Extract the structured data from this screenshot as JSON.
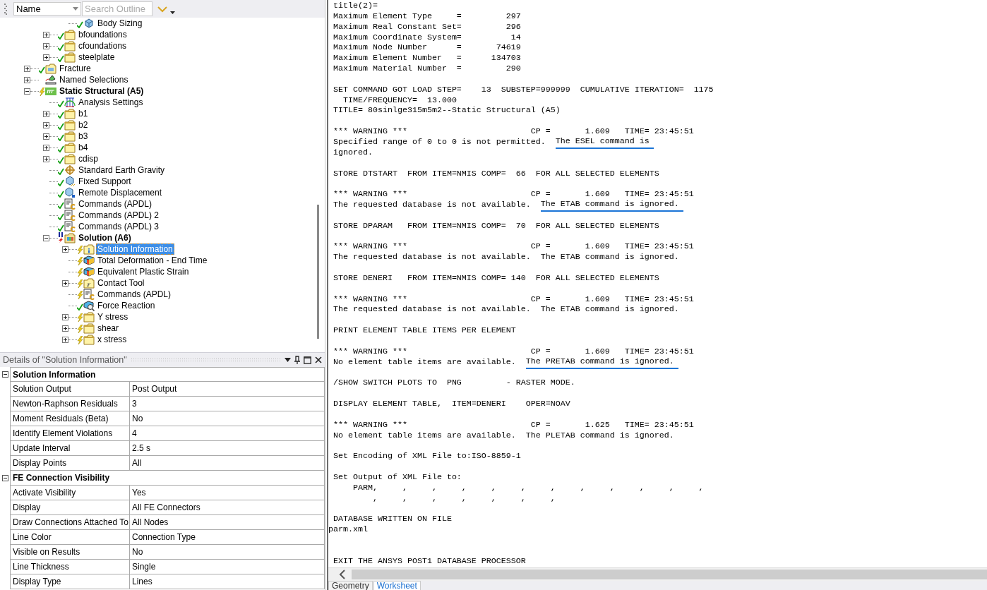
{
  "outline_toolbar": {
    "column_dropdown": "Name",
    "search": {
      "placeholder": "Search Outline"
    }
  },
  "tree": [
    {
      "children": [
        {
          "children": [
            {
              "label": "Body Sizing",
              "kind": "mesh-sizing",
              "up_to_date": true,
              "selected": false
            }
          ]
        },
        {
          "label": "bfoundations",
          "kind": "folder",
          "up_to_date": true,
          "expanded": false,
          "selected": false
        },
        {
          "label": "cfoundations",
          "kind": "folder",
          "up_to_date": true,
          "expanded": false,
          "selected": false
        },
        {
          "label": "steelplate",
          "kind": "folder",
          "up_to_date": true,
          "expanded": false,
          "selected": false
        }
      ]
    },
    {
      "label": "Fracture",
      "kind": "fracture",
      "up_to_date": true,
      "expanded": false,
      "selected": false
    },
    {
      "label": "Named Selections",
      "kind": "named-selection",
      "expanded": false,
      "selected": false
    },
    {
      "label": "Static Structural (A5)",
      "kind": "analysis",
      "up_to_date": false,
      "expanded": true,
      "selected": false,
      "children": [
        {
          "label": "Analysis Settings",
          "kind": "analysis-settings",
          "up_to_date": true,
          "selected": false
        },
        {
          "label": "b1",
          "kind": "folder",
          "up_to_date": true,
          "expanded": false,
          "selected": false
        },
        {
          "label": "b2",
          "kind": "folder",
          "up_to_date": true,
          "expanded": false,
          "selected": false
        },
        {
          "label": "b3",
          "kind": "folder",
          "up_to_date": true,
          "expanded": false,
          "selected": false
        },
        {
          "label": "b4",
          "kind": "folder",
          "up_to_date": true,
          "expanded": false,
          "selected": false
        },
        {
          "label": "cdisp",
          "kind": "folder",
          "up_to_date": true,
          "expanded": false,
          "selected": false
        },
        {
          "label": "Standard Earth Gravity",
          "kind": "gravity",
          "up_to_date": true,
          "selected": false
        },
        {
          "label": "Fixed Support",
          "kind": "fixed-support",
          "up_to_date": true,
          "selected": false
        },
        {
          "label": "Remote Displacement",
          "kind": "remote-displacement",
          "up_to_date": true,
          "selected": false
        },
        {
          "label": "Commands (APDL)",
          "kind": "commands",
          "up_to_date": true,
          "selected": false
        },
        {
          "label": "Commands (APDL) 2",
          "kind": "commands",
          "up_to_date": true,
          "selected": false
        },
        {
          "label": "Commands (APDL) 3",
          "kind": "commands",
          "up_to_date": true,
          "selected": false
        },
        {
          "label": "Solution (A6)",
          "kind": "solution",
          "up_to_date": false,
          "solving": true,
          "expanded": true,
          "selected": false,
          "children": [
            {
              "label": "Solution Information",
              "kind": "solution-info",
              "up_to_date": false,
              "expanded": false,
              "selected": true
            },
            {
              "label": "Total Deformation - End Time",
              "kind": "result",
              "up_to_date": false,
              "selected": false
            },
            {
              "label": "Equivalent Plastic Strain",
              "kind": "result",
              "up_to_date": false,
              "selected": false
            },
            {
              "label": "Contact Tool",
              "kind": "contact-tool",
              "up_to_date": false,
              "expanded": false,
              "selected": false
            },
            {
              "label": "Commands (APDL)",
              "kind": "commands",
              "up_to_date": false,
              "selected": false
            },
            {
              "label": "Force Reaction",
              "kind": "probe",
              "up_to_date": true,
              "selected": false
            },
            {
              "label": "Y stress",
              "kind": "folder",
              "up_to_date": false,
              "expanded": false,
              "selected": false
            },
            {
              "label": "shear",
              "kind": "folder",
              "up_to_date": false,
              "expanded": false,
              "selected": false
            },
            {
              "label": "x stress",
              "kind": "folder",
              "up_to_date": false,
              "expanded": false,
              "selected": false
            }
          ]
        }
      ]
    }
  ],
  "details": {
    "title": "Details of \"Solution Information\"",
    "sections": [
      {
        "title": "Solution Information",
        "expanded": true,
        "rows": [
          {
            "label": "Solution Output",
            "value": "Post Output"
          },
          {
            "label": "Newton-Raphson Residuals",
            "value": "3"
          },
          {
            "label": "Moment Residuals (Beta)",
            "value": "No"
          },
          {
            "label": "Identify Element Violations",
            "value": "4"
          },
          {
            "label": "Update Interval",
            "value": "2.5 s"
          },
          {
            "label": "Display Points",
            "value": "All"
          }
        ]
      },
      {
        "title": "FE Connection Visibility",
        "expanded": true,
        "rows": [
          {
            "label": "Activate Visibility",
            "value": "Yes"
          },
          {
            "label": "Display",
            "value": "All FE Connectors"
          },
          {
            "label": "Draw Connections Attached To",
            "value": "All Nodes"
          },
          {
            "label": "Line Color",
            "value": "Connection Type"
          },
          {
            "label": "Visible on Results",
            "value": "No"
          },
          {
            "label": "Line Thickness",
            "value": "Single"
          },
          {
            "label": "Display Type",
            "value": "Lines"
          }
        ]
      }
    ]
  },
  "log": [
    {
      "kind": "line",
      "text": "title(2)="
    },
    {
      "kind": "line",
      "text": "Maximum Element Type     =         297"
    },
    {
      "kind": "line",
      "text": "Maximum Real Constant Set=         296"
    },
    {
      "kind": "line",
      "text": "Maximum Coordinate System=          14"
    },
    {
      "kind": "line",
      "text": "Maximum Node Number      =       74619"
    },
    {
      "kind": "line",
      "text": "Maximum Element Number   =      134703"
    },
    {
      "kind": "line",
      "text": "Maximum Material Number  =         290"
    },
    {
      "kind": "blank"
    },
    {
      "kind": "line",
      "text": "SET COMMAND GOT LOAD STEP=    13  SUBSTEP=999999  CUMULATIVE ITERATION=  1175"
    },
    {
      "kind": "line",
      "text": "  TIME/FREQUENCY=  13.000"
    },
    {
      "kind": "line",
      "text": "TITLE= 80sinlge315m5m2--Static Structural (A5)"
    },
    {
      "kind": "blank"
    },
    {
      "kind": "line",
      "text": "*** WARNING ***                         CP =       1.609   TIME= 23:45:51"
    },
    {
      "kind": "line",
      "text": "Specified range of 0 to 0 is not permitted.",
      "underlined_text": "The ESEL command is"
    },
    {
      "kind": "line",
      "text": "ignored."
    },
    {
      "kind": "blank"
    },
    {
      "kind": "line",
      "text": "STORE DTSTART  FROM ITEM=NMIS COMP=  66  FOR ALL SELECTED ELEMENTS"
    },
    {
      "kind": "blank"
    },
    {
      "kind": "line",
      "text": "*** WARNING ***                         CP =       1.609   TIME= 23:45:51"
    },
    {
      "kind": "line",
      "text": "The requested database is not available.",
      "underlined_text": "The ETAB command is ignored."
    },
    {
      "kind": "blank"
    },
    {
      "kind": "line",
      "text": "STORE DPARAM   FROM ITEM=NMIS COMP=  70  FOR ALL SELECTED ELEMENTS"
    },
    {
      "kind": "blank"
    },
    {
      "kind": "line",
      "text": "*** WARNING ***                         CP =       1.609   TIME= 23:45:51"
    },
    {
      "kind": "line",
      "text": "The requested database is not available.  The ETAB command is ignored."
    },
    {
      "kind": "blank"
    },
    {
      "kind": "line",
      "text": "STORE DENERI   FROM ITEM=NMIS COMP= 140  FOR ALL SELECTED ELEMENTS"
    },
    {
      "kind": "blank"
    },
    {
      "kind": "line",
      "text": "*** WARNING ***                         CP =       1.609   TIME= 23:45:51"
    },
    {
      "kind": "line",
      "text": "The requested database is not available.  The ETAB command is ignored."
    },
    {
      "kind": "blank"
    },
    {
      "kind": "line",
      "text": "PRINT ELEMENT TABLE ITEMS PER ELEMENT"
    },
    {
      "kind": "blank"
    },
    {
      "kind": "line",
      "text": "*** WARNING ***                         CP =       1.609   TIME= 23:45:51"
    },
    {
      "kind": "line",
      "text": "No element table items are available.",
      "underlined_text": "The PRETAB command is ignored."
    },
    {
      "kind": "blank"
    },
    {
      "kind": "line",
      "text": "/SHOW SWITCH PLOTS TO  PNG         - RASTER MODE."
    },
    {
      "kind": "blank"
    },
    {
      "kind": "line",
      "text": "DISPLAY ELEMENT TABLE,  ITEM=DENERI    OPER=NOAV"
    },
    {
      "kind": "blank"
    },
    {
      "kind": "line",
      "text": "*** WARNING ***                         CP =       1.625   TIME= 23:45:51"
    },
    {
      "kind": "line",
      "text": "No element table items are available.  The PLETAB command is ignored."
    },
    {
      "kind": "blank"
    },
    {
      "kind": "line",
      "text": "Set Encoding of XML File to:ISO-8859-1"
    },
    {
      "kind": "blank"
    },
    {
      "kind": "line",
      "text": "Set Output of XML File to:"
    },
    {
      "kind": "line",
      "text": "    PARM,     ,     ,     ,     ,     ,     ,     ,     ,     ,     ,     ,"
    },
    {
      "kind": "line",
      "text": "        ,     ,     ,     ,     ,     ,     ,"
    },
    {
      "kind": "blank"
    },
    {
      "kind": "line",
      "text": "DATABASE WRITTEN ON FILE"
    },
    {
      "kind": "flush",
      "text": "parm.xml"
    },
    {
      "kind": "blank"
    },
    {
      "kind": "blank"
    },
    {
      "kind": "line",
      "text": "EXIT THE ANSYS POST1 DATABASE PROCESSOR"
    }
  ],
  "tabs": [
    {
      "label": "Geometry",
      "selected": false
    },
    {
      "label": "Worksheet",
      "selected": true
    }
  ]
}
